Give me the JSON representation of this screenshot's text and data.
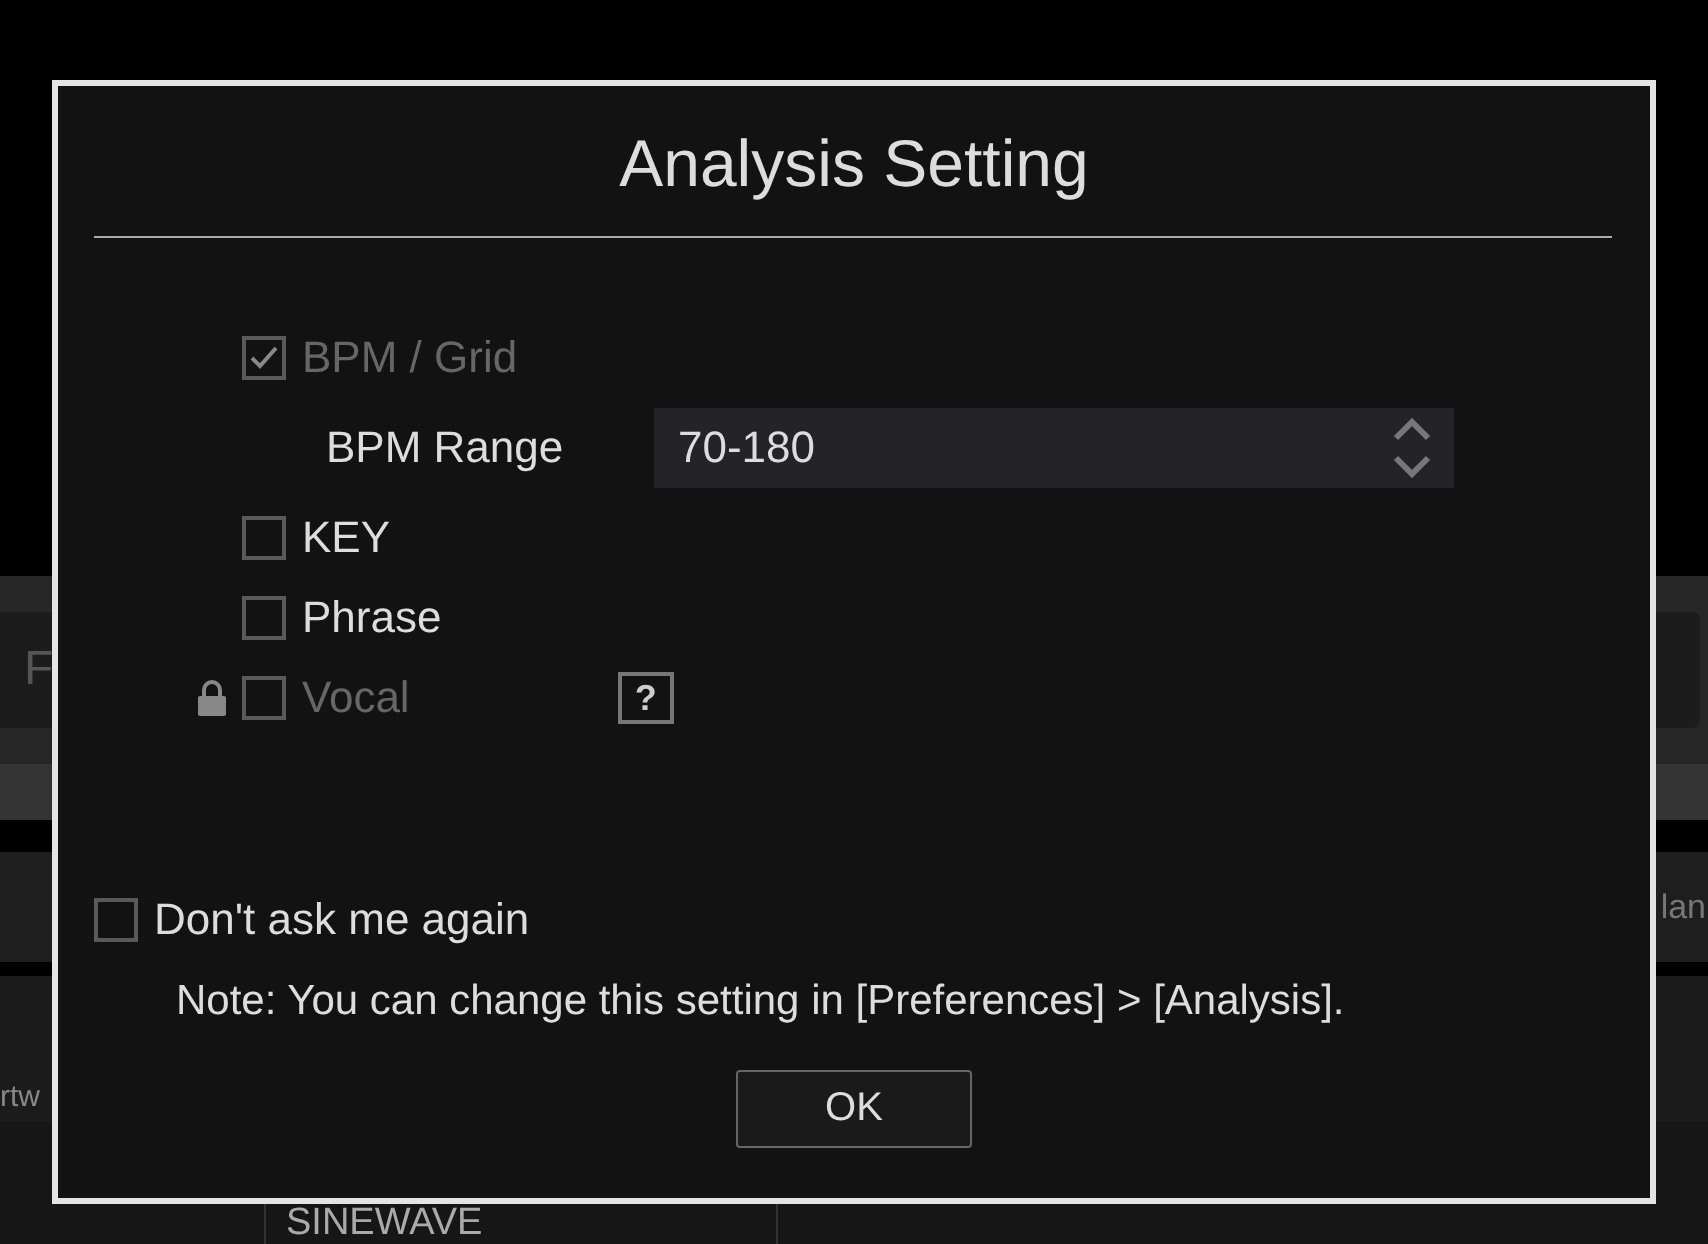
{
  "background": {
    "field_text": "F",
    "left_label": "rtw",
    "right_label": "lan",
    "track_title": "SINEWAVE"
  },
  "dialog": {
    "title": "Analysis Setting",
    "options": [
      {
        "kind": "checkbox",
        "label": "BPM / Grid",
        "checked": true,
        "disabled": true,
        "locked": false
      },
      {
        "kind": "select",
        "label": "BPM Range",
        "value": "70-180"
      },
      {
        "kind": "checkbox",
        "label": "KEY",
        "checked": false,
        "disabled": false,
        "locked": false
      },
      {
        "kind": "checkbox",
        "label": "Phrase",
        "checked": false,
        "disabled": false,
        "locked": false
      },
      {
        "kind": "checkbox",
        "label": "Vocal",
        "checked": false,
        "disabled": true,
        "locked": true,
        "help": "?"
      }
    ],
    "dont_ask": {
      "label": "Don't ask me again",
      "checked": false
    },
    "note": "Note: You can change this setting in [Preferences] > [Analysis].",
    "button": "OK"
  }
}
